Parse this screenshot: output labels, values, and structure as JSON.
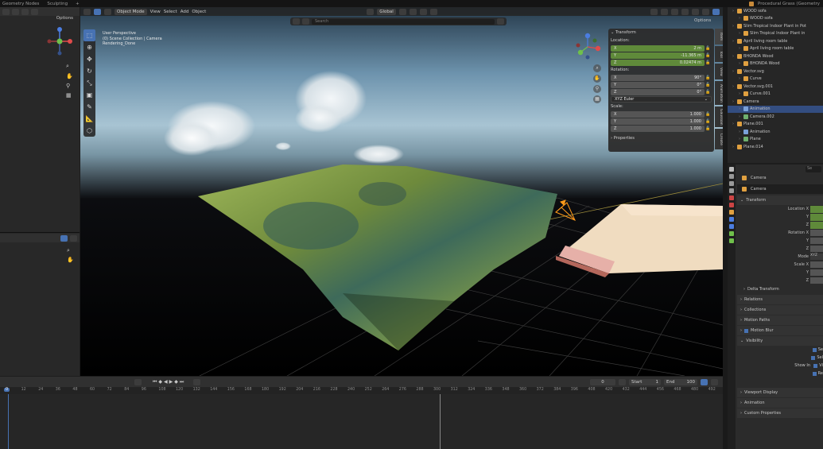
{
  "topbar": {
    "tabs": [
      "Geometry Nodes",
      "Sculpting"
    ],
    "add_tab": "+",
    "file_title": "Procedural Grass (Geometry"
  },
  "left": {
    "options": "Options"
  },
  "viewport": {
    "mode": "Object Mode",
    "menus": [
      "View",
      "Select",
      "Add",
      "Object"
    ],
    "transform_orientation": "Global",
    "search_placeholder": "Search",
    "options": "Options",
    "overlay": {
      "line1": "User Perspective",
      "line2": "(0) Scene Collection | Camera",
      "line3": "Rendering_Done"
    },
    "gizmo": {
      "x": "X",
      "y": "Y",
      "z": "Z"
    },
    "npanel": {
      "transform": "Transform",
      "location": "Location:",
      "rotation": "Rotation:",
      "scale": "Scale:",
      "loc": [
        {
          "a": "X",
          "v": "2 m"
        },
        {
          "a": "Y",
          "v": "-11.365 m"
        },
        {
          "a": "Z",
          "v": "0.02474 m"
        }
      ],
      "rot": [
        {
          "a": "X",
          "v": "90°"
        },
        {
          "a": "Y",
          "v": "0°"
        },
        {
          "a": "Z",
          "v": "0°"
        }
      ],
      "mode": "XYZ Euler",
      "scl": [
        {
          "a": "X",
          "v": "1.000"
        },
        {
          "a": "Y",
          "v": "1.000"
        },
        {
          "a": "Z",
          "v": "1.000"
        }
      ],
      "properties": "Properties",
      "side_tabs": [
        "Item",
        "Tool",
        "View",
        "Animation",
        "Gaussian",
        "Create"
      ]
    }
  },
  "timeline": {
    "current_frame": "0",
    "start_label": "Start",
    "start": "1",
    "end_label": "End",
    "end": "100",
    "ticks": [
      "0",
      "12",
      "24",
      "36",
      "48",
      "60",
      "72",
      "84",
      "96",
      "108",
      "120",
      "132",
      "144",
      "156",
      "168",
      "180",
      "192",
      "204",
      "216",
      "228",
      "240",
      "252",
      "264",
      "276",
      "288",
      "300",
      "312",
      "324",
      "336",
      "348",
      "360",
      "372",
      "384",
      "396",
      "408",
      "420",
      "432",
      "444",
      "456",
      "468",
      "480",
      "492"
    ]
  },
  "outliner": {
    "items": [
      {
        "d": 0,
        "label": "WOOD sofa",
        "c": "#e0a040"
      },
      {
        "d": 1,
        "label": "WOOD sofa",
        "c": "#e0a040"
      },
      {
        "d": 0,
        "label": "Slim Tropical Indoor Plant in Pot",
        "c": "#e0a040"
      },
      {
        "d": 1,
        "label": "Slim Tropical Indoor Plant in",
        "c": "#e0a040"
      },
      {
        "d": 0,
        "label": "April living room table",
        "c": "#e0a040"
      },
      {
        "d": 1,
        "label": "April living room table",
        "c": "#e0a040"
      },
      {
        "d": 0,
        "label": "BHONDA Wood",
        "c": "#e0a040"
      },
      {
        "d": 1,
        "label": "BHONDA Wood",
        "c": "#e0a040"
      },
      {
        "d": 0,
        "label": "Vector.svg",
        "c": "#e0a040"
      },
      {
        "d": 1,
        "label": "Curve",
        "c": "#e0a040"
      },
      {
        "d": 0,
        "label": "Vector.svg.001",
        "c": "#e0a040"
      },
      {
        "d": 1,
        "label": "Curve.001",
        "c": "#e0a040"
      },
      {
        "d": 0,
        "label": "Camera",
        "c": "#e0a040"
      },
      {
        "d": 1,
        "label": "Animation",
        "c": "#7aa0d8",
        "sel": true
      },
      {
        "d": 1,
        "label": "Camera.002",
        "c": "#6fb06f"
      },
      {
        "d": 0,
        "label": "Plane.001",
        "c": "#e0a040"
      },
      {
        "d": 1,
        "label": "Animation",
        "c": "#7aa0d8"
      },
      {
        "d": 1,
        "label": "Plane",
        "c": "#6fb06f"
      },
      {
        "d": 0,
        "label": "Plane.014",
        "c": "#e0a040"
      }
    ]
  },
  "properties": {
    "search": "Se",
    "object_label": "Camera",
    "name": "Camera",
    "transform": "Transform",
    "rows": [
      "Location X",
      "Y",
      "Z",
      "Rotation X",
      "Y",
      "Z",
      "Mode",
      "Scale X",
      "Y",
      "Z"
    ],
    "mode_value": "XYZ",
    "delta": "Delta Transform",
    "panels": [
      "Relations",
      "Collections",
      "Motion Paths",
      "Motion Blur",
      "Visibility"
    ],
    "vis": [
      "Se",
      "Sel",
      "Show In",
      "Vi",
      "Re"
    ],
    "bottom": [
      "Viewport Display",
      "Animation",
      "Custom Properties"
    ]
  }
}
